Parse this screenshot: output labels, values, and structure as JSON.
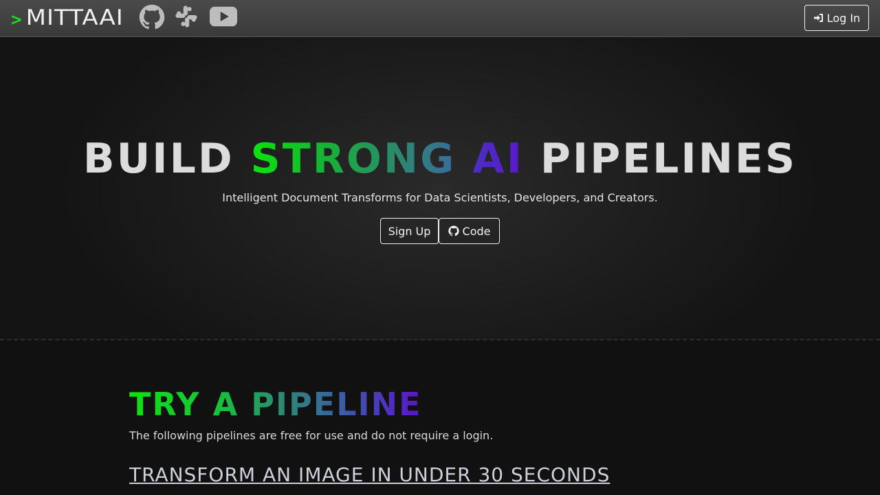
{
  "navbar": {
    "brand_caret": ">",
    "brand_name": "MITTAAI",
    "icons": [
      "github-icon",
      "slack-icon",
      "youtube-icon"
    ],
    "login_label": "Log In",
    "login_icon": "sign-in-icon"
  },
  "hero": {
    "title_part1": "BUILD ",
    "title_strong": "STRONG",
    "title_space": " ",
    "title_ai": "AI",
    "title_part2": " PIPELINES",
    "subtitle": "Intelligent Document Transforms for Data Scientists, Developers, and Creators.",
    "signup_label": "Sign Up",
    "code_label": "Code",
    "code_icon": "github-icon"
  },
  "try_section": {
    "title": "TRY A PIPELINE",
    "description": "The following pipelines are free for use and do not require a login.",
    "first_pipeline_link": "TRANSFORM AN IMAGE IN UNDER 30 SECONDS"
  },
  "colors": {
    "accent_green": "#1ed61e",
    "accent_purple": "#5a12d0",
    "background": "#111111",
    "navbar": "#444444"
  }
}
